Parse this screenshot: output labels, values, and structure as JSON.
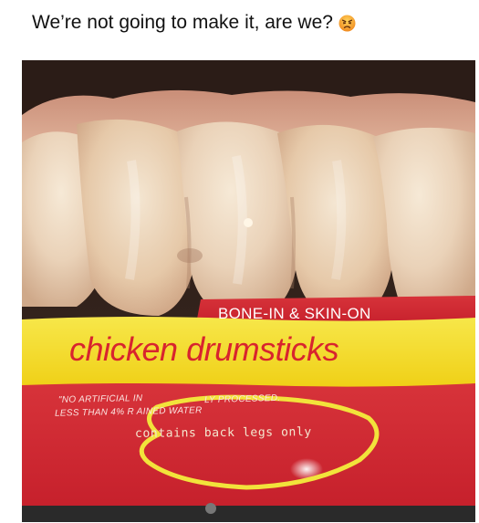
{
  "caption": {
    "text": "We’re not going to make it, are we?",
    "emoji": "angry-face-icon"
  },
  "package": {
    "banner_label": "BONE-IN & SKIN-ON",
    "product_title": "chicken drumsticks",
    "claim_line_1": "\"NO ARTIFICIAL IN",
    "claim_line_2": "LESS THAN 4% R",
    "claim_line_2b": "AINED WATER",
    "claim_line_3": "LY PROCESSED.",
    "note": "contains back legs only"
  },
  "colors": {
    "banner_red": "#cf2630",
    "label_yellow": "#f3dd1e",
    "circle_yellow": "#f2e33b",
    "emoji_orange": "#f59a2c"
  }
}
